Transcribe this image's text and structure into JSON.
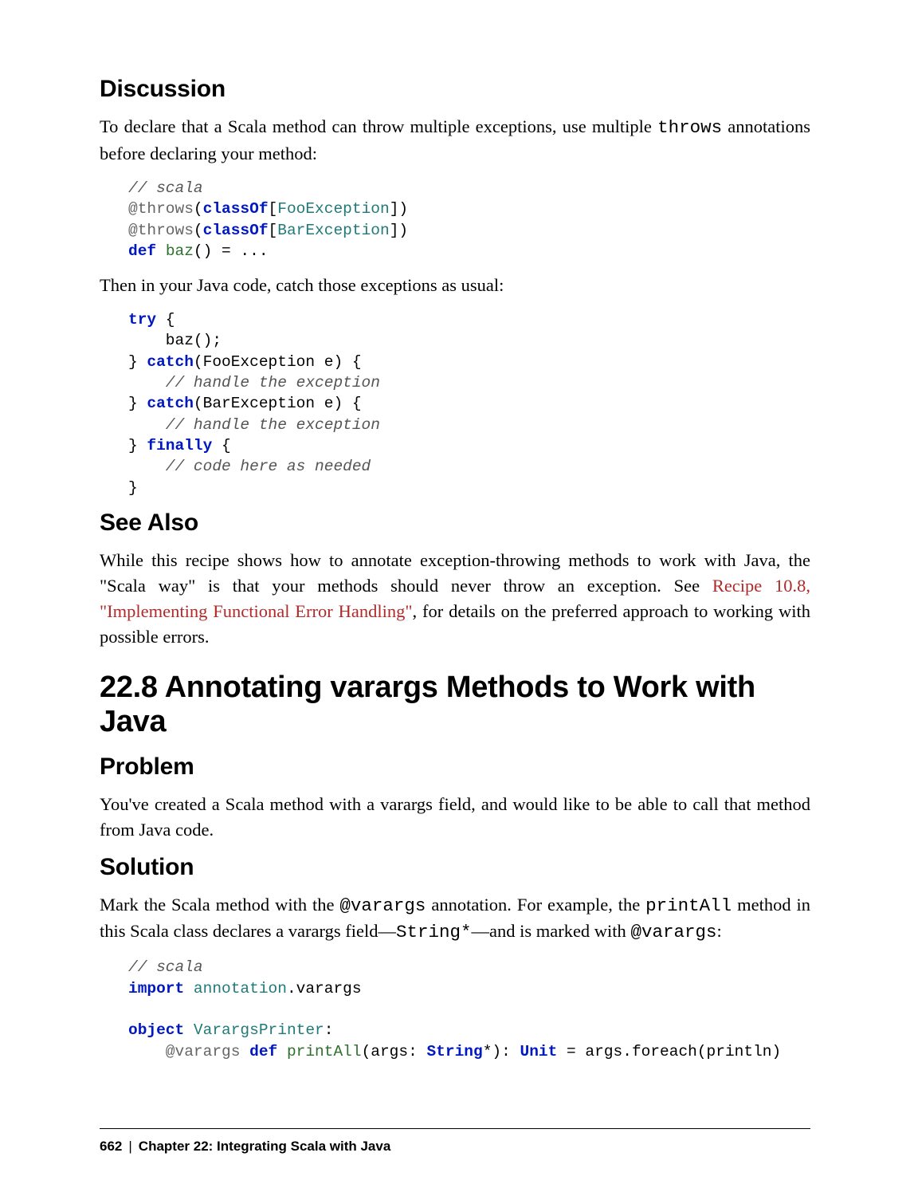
{
  "sections": {
    "discussion": {
      "heading": "Discussion",
      "p1_a": "To declare that a Scala method can throw multiple exceptions, use multiple ",
      "p1_code": "throws",
      "p1_b": " annotations before declaring your method:",
      "p2": "Then in your Java code, catch those exceptions as usual:"
    },
    "seealso": {
      "heading": "See Also",
      "p1_a": "While this recipe shows how to annotate exception-throwing methods to work with Java, the \"Scala way\" is that your methods should never throw an exception. See ",
      "link": "Recipe 10.8, \"Implementing Functional Error Handling\"",
      "p1_b": ", for details on the preferred approach to working with possible errors."
    },
    "recipe": {
      "heading": "22.8 Annotating varargs Methods to Work with Java"
    },
    "problem": {
      "heading": "Problem",
      "p1": "You've created a Scala method with a varargs field, and would like to be able to call that method from Java code."
    },
    "solution": {
      "heading": "Solution",
      "p1_a": "Mark the Scala method with the ",
      "p1_code1": "@varargs",
      "p1_b": " annotation. For example, the ",
      "p1_code2": "printAll",
      "p1_c": " method in this Scala class declares a varargs field—",
      "p1_code3": "String*",
      "p1_d": "—and is marked with ",
      "p1_code4": "@varargs",
      "p1_e": ":"
    }
  },
  "code": {
    "c1": {
      "l1": "// scala",
      "l2a": "@throws",
      "l2b": "(",
      "l2c": "classOf",
      "l2d": "[",
      "l2e": "FooException",
      "l2f": "])",
      "l3a": "@throws",
      "l3b": "(",
      "l3c": "classOf",
      "l3d": "[",
      "l3e": "BarException",
      "l3f": "])",
      "l4a": "def",
      "l4b": " ",
      "l4c": "baz",
      "l4d": "() = ..."
    },
    "c2": {
      "l1a": "try",
      "l1b": " {",
      "l2": "    baz();",
      "l3a": "} ",
      "l3b": "catch",
      "l3c": "(FooException e) {",
      "l4": "    // handle the exception",
      "l5a": "} ",
      "l5b": "catch",
      "l5c": "(BarException e) {",
      "l6": "    // handle the exception",
      "l7a": "} ",
      "l7b": "finally",
      "l7c": " {",
      "l8": "    // code here as needed",
      "l9": "}"
    },
    "c3": {
      "l1": "// scala",
      "l2a": "import",
      "l2b": " ",
      "l2c": "annotation",
      "l2d": ".varargs",
      "l3": "",
      "l4a": "object",
      "l4b": " ",
      "l4c": "VarargsPrinter",
      "l4d": ":",
      "l5a": "    @varargs ",
      "l5b": "def",
      "l5c": " ",
      "l5d": "printAll",
      "l5e": "(args: ",
      "l5f": "String",
      "l5g": "*): ",
      "l5h": "Unit",
      "l5i": " = args.foreach(println)"
    }
  },
  "footer": {
    "page": "662",
    "separator": "|",
    "chapter": "Chapter 22: Integrating Scala with Java"
  }
}
